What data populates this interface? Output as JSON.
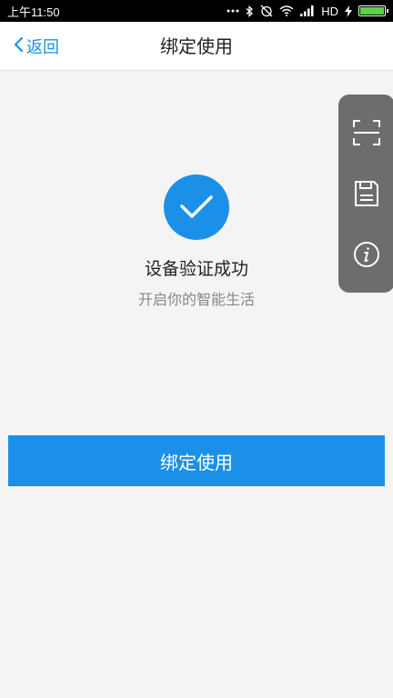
{
  "status_bar": {
    "time": "上午11:50",
    "network": "HD"
  },
  "header": {
    "back_label": "返回",
    "title": "绑定使用"
  },
  "success": {
    "title": "设备验证成功",
    "subtitle": "开启你的智能生活"
  },
  "bind_button": {
    "label": "绑定使用"
  },
  "floating_toolbar": {
    "items": [
      {
        "icon": "scan-frame-icon"
      },
      {
        "icon": "save-disk-icon"
      },
      {
        "icon": "info-icon"
      }
    ]
  },
  "colors": {
    "accent": "#1a90e8",
    "background": "#f4f4f4",
    "toolbar": "#6d6d6d",
    "battery": "#5dd14a"
  }
}
